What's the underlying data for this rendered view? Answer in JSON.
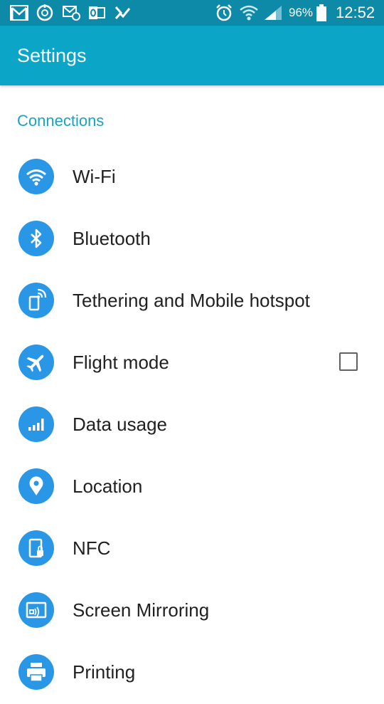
{
  "status_bar": {
    "battery_percent": "96%",
    "time": "12:52",
    "notification_icons": [
      "gmail-icon",
      "sync-icon",
      "email-icon",
      "outlook-icon",
      "tasks-icon"
    ],
    "system_icons": [
      "alarm-icon",
      "wifi-icon",
      "signal-icon",
      "battery-icon"
    ]
  },
  "app_bar": {
    "title": "Settings"
  },
  "section": {
    "title": "Connections"
  },
  "items": [
    {
      "label": "Wi-Fi",
      "icon": "wifi-icon"
    },
    {
      "label": "Bluetooth",
      "icon": "bluetooth-icon"
    },
    {
      "label": "Tethering and Mobile hotspot",
      "icon": "hotspot-icon"
    },
    {
      "label": "Flight mode",
      "icon": "airplane-icon",
      "checked": false
    },
    {
      "label": "Data usage",
      "icon": "data-usage-icon"
    },
    {
      "label": "Location",
      "icon": "location-pin-icon"
    },
    {
      "label": "NFC",
      "icon": "nfc-icon"
    },
    {
      "label": "Screen Mirroring",
      "icon": "screen-mirroring-icon"
    },
    {
      "label": "Printing",
      "icon": "printer-icon"
    }
  ],
  "colors": {
    "status_bar": "#0d8aa8",
    "app_bar": "#0ba6c7",
    "section_header": "#1aa3bf",
    "icon_circle": "#2997e6",
    "label_text": "#212121"
  }
}
